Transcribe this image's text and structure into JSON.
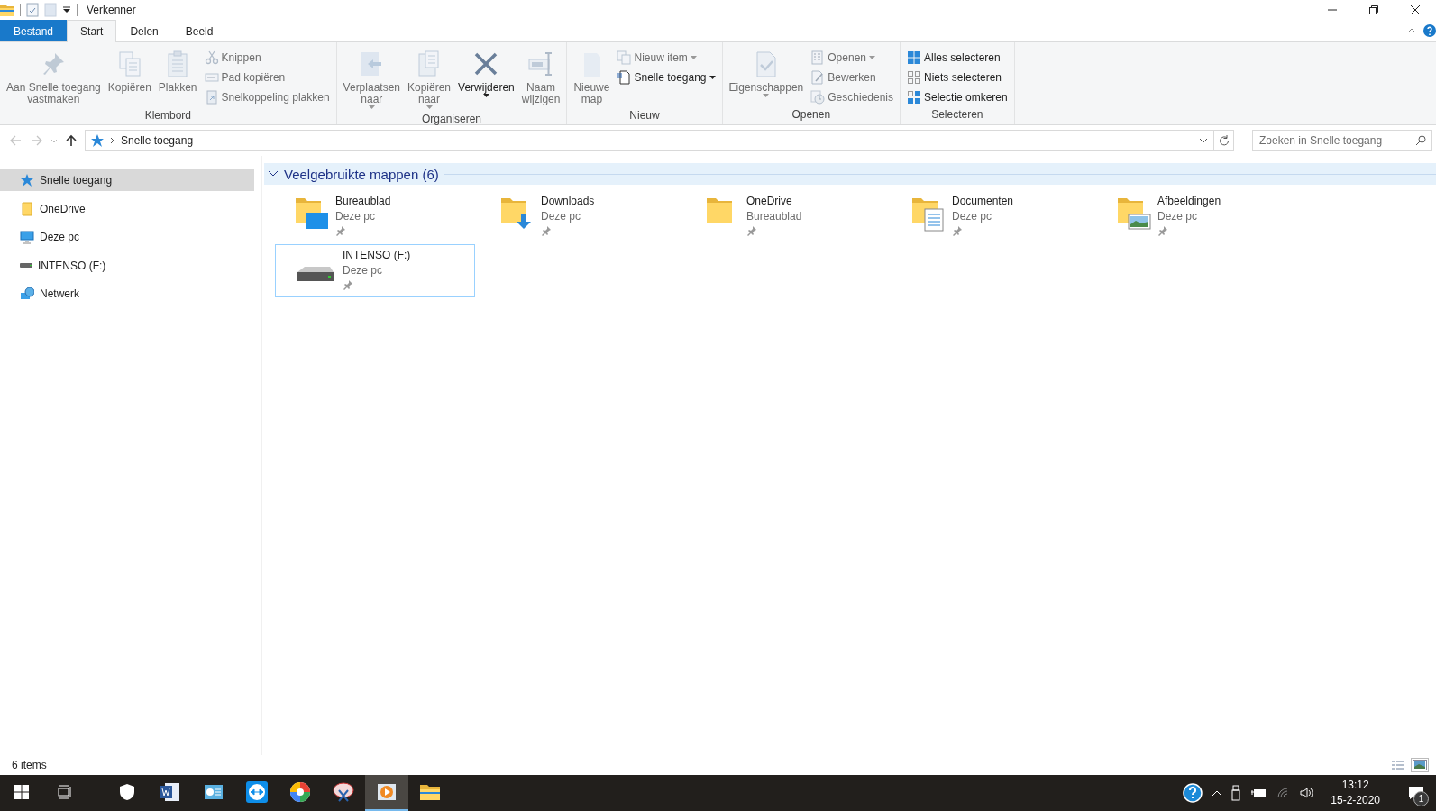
{
  "window": {
    "title": "Verkenner"
  },
  "ribbon_tabs": [
    {
      "label": "Bestand",
      "kind": "file",
      "selected": false
    },
    {
      "label": "Start",
      "kind": "tab",
      "selected": true
    },
    {
      "label": "Delen",
      "kind": "tab",
      "selected": false
    },
    {
      "label": "Beeld",
      "kind": "tab",
      "selected": false
    }
  ],
  "ribbon_groups": [
    {
      "label": "Klembord",
      "items": [
        {
          "kind": "large",
          "lines": [
            "Aan Snelle toegang",
            "vastmaken"
          ],
          "disabled": true,
          "dropdown": false
        },
        {
          "kind": "large",
          "lines": [
            "Kopiëren"
          ],
          "disabled": true,
          "dropdown": false
        },
        {
          "kind": "large",
          "lines": [
            "Plakken"
          ],
          "disabled": true,
          "dropdown": false
        },
        {
          "kind": "small",
          "lines": [
            "Knippen"
          ],
          "disabled": true,
          "dropdown": false
        },
        {
          "kind": "small",
          "lines": [
            "Pad kopiëren"
          ],
          "disabled": true,
          "dropdown": false
        },
        {
          "kind": "small",
          "lines": [
            "Snelkoppeling plakken"
          ],
          "disabled": true,
          "dropdown": false
        }
      ]
    },
    {
      "label": "Organiseren",
      "items": [
        {
          "kind": "large",
          "lines": [
            "Verplaatsen",
            "naar"
          ],
          "disabled": true,
          "dropdown": true
        },
        {
          "kind": "large",
          "lines": [
            "Kopiëren",
            "naar"
          ],
          "disabled": true,
          "dropdown": true
        },
        {
          "kind": "large",
          "lines": [
            "Verwijderen"
          ],
          "disabled": false,
          "dropdown": true
        },
        {
          "kind": "large",
          "lines": [
            "Naam",
            "wijzigen"
          ],
          "disabled": true,
          "dropdown": false
        }
      ]
    },
    {
      "label": "Nieuw",
      "items": [
        {
          "kind": "large",
          "lines": [
            "Nieuwe",
            "map"
          ],
          "disabled": true,
          "dropdown": false
        },
        {
          "kind": "small",
          "lines": [
            "Nieuw item"
          ],
          "disabled": true,
          "dropdown": true
        },
        {
          "kind": "small",
          "lines": [
            "Snelle toegang"
          ],
          "disabled": false,
          "dropdown": true
        }
      ]
    },
    {
      "label": "Openen",
      "items": [
        {
          "kind": "large",
          "lines": [
            "Eigenschappen"
          ],
          "disabled": true,
          "dropdown": true
        },
        {
          "kind": "small",
          "lines": [
            "Openen"
          ],
          "disabled": true,
          "dropdown": true
        },
        {
          "kind": "small",
          "lines": [
            "Bewerken"
          ],
          "disabled": true,
          "dropdown": false
        },
        {
          "kind": "small",
          "lines": [
            "Geschiedenis"
          ],
          "disabled": true,
          "dropdown": false
        }
      ]
    },
    {
      "label": "Selecteren",
      "items": [
        {
          "kind": "small",
          "lines": [
            "Alles selecteren"
          ],
          "disabled": false,
          "dropdown": false
        },
        {
          "kind": "small",
          "lines": [
            "Niets selecteren"
          ],
          "disabled": false,
          "dropdown": false
        },
        {
          "kind": "small",
          "lines": [
            "Selectie omkeren"
          ],
          "disabled": false,
          "dropdown": false
        }
      ]
    }
  ],
  "navigation": [
    {
      "disabled": true
    },
    {
      "disabled": true
    },
    {
      "disabled": false
    }
  ],
  "address": {
    "path": [
      "Snelle toegang"
    ]
  },
  "search": {
    "placeholder": "Zoeken in Snelle toegang"
  },
  "sidebar": {
    "items": [
      {
        "label": "Snelle toegang",
        "selected": true
      },
      {
        "label": "OneDrive",
        "selected": false
      },
      {
        "label": "Deze pc",
        "selected": false
      },
      {
        "label": "INTENSO (F:)",
        "selected": false
      },
      {
        "label": "Netwerk",
        "selected": false
      }
    ]
  },
  "group": {
    "title": "Veelgebruikte mappen (6)",
    "expanded": true,
    "items": [
      {
        "name": "Bureaublad",
        "location": "Deze pc",
        "pinned": true,
        "selected": false
      },
      {
        "name": "Downloads",
        "location": "Deze pc",
        "pinned": true,
        "selected": false
      },
      {
        "name": "OneDrive",
        "location": "Bureaublad",
        "pinned": true,
        "selected": false
      },
      {
        "name": "Documenten",
        "location": "Deze pc",
        "pinned": true,
        "selected": false
      },
      {
        "name": "Afbeeldingen",
        "location": "Deze pc",
        "pinned": true,
        "selected": false
      },
      {
        "name": "INTENSO (F:)",
        "location": "Deze pc",
        "pinned": true,
        "selected": true
      }
    ]
  },
  "status_bar": {
    "text": "6 items",
    "views": [
      {
        "selected": false
      },
      {
        "selected": true
      }
    ]
  },
  "taskbar": {
    "apps": [
      {
        "selected": false
      },
      {
        "selected": false
      },
      {
        "selected": false
      },
      {
        "selected": false
      },
      {
        "selected": false
      },
      {
        "selected": false
      },
      {
        "selected": true
      },
      {
        "selected": false
      }
    ],
    "time": "13:12",
    "date": "15-2-2020",
    "notifications": "1"
  }
}
